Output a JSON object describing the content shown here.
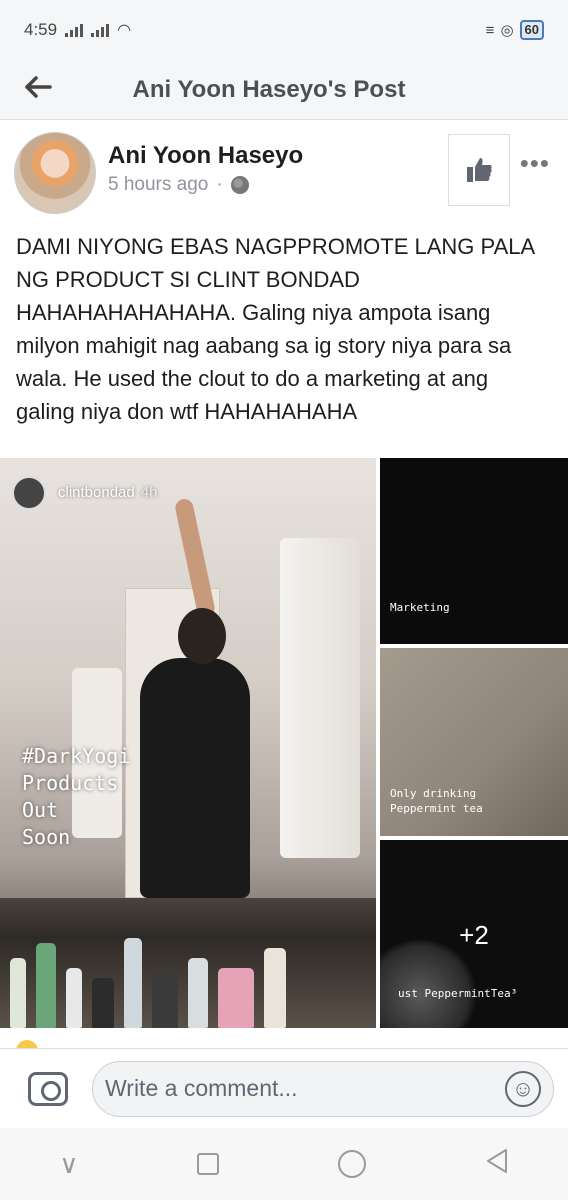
{
  "status_bar": {
    "time": "4:59",
    "battery": "60"
  },
  "nav": {
    "title": "Ani Yoon Haseyo's Post"
  },
  "post": {
    "author": "Ani Yoon Haseyo",
    "timestamp": "5 hours ago",
    "separator": "·",
    "text": "DAMI NIYONG EBAS NAGPPROMOTE LANG PALA NG PRODUCT SI CLINT BONDAD HAHAHAHAHAHAHA. Galing niya ampota isang milyon mahigit nag aabang sa ig story niya para sa wala. He used the clout to do a marketing at ang galing niya don wtf HAHAHAHAHA"
  },
  "gallery": {
    "main": {
      "ig_username": "clintbondad",
      "ig_time": "4h",
      "caption_lines": [
        "#DarkYogi",
        "Products",
        "Out",
        "Soon"
      ]
    },
    "thumbs": [
      {
        "caption": "Marketing"
      },
      {
        "caption_lines": [
          "Only drinking",
          "Peppermint tea"
        ]
      },
      {
        "caption": "ust PeppermintTea³",
        "more_count": "+2"
      }
    ]
  },
  "comment": {
    "placeholder": "Write a comment..."
  },
  "icons": {
    "back": "back-arrow-icon",
    "like": "thumbs-up-icon",
    "more": "more-options-icon",
    "camera": "camera-icon",
    "emoji": "smiley-icon",
    "globe": "globe-icon"
  },
  "colors": {
    "text": "#1c1e21",
    "meta": "#90949c",
    "nav_bg": "#f5f6f7",
    "icon_gray": "#606770"
  }
}
